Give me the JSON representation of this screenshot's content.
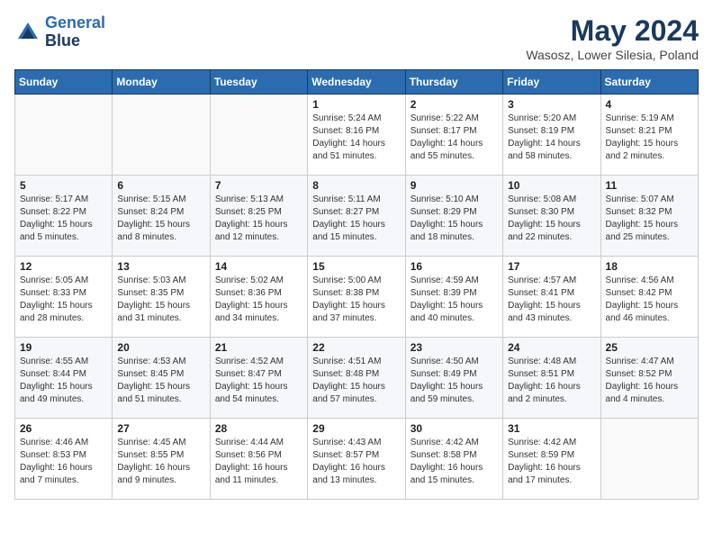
{
  "logo": {
    "line1": "General",
    "line2": "Blue"
  },
  "title": "May 2024",
  "subtitle": "Wasosz, Lower Silesia, Poland",
  "weekdays": [
    "Sunday",
    "Monday",
    "Tuesday",
    "Wednesday",
    "Thursday",
    "Friday",
    "Saturday"
  ],
  "weeks": [
    [
      {
        "day": "",
        "info": ""
      },
      {
        "day": "",
        "info": ""
      },
      {
        "day": "",
        "info": ""
      },
      {
        "day": "1",
        "info": "Sunrise: 5:24 AM\nSunset: 8:16 PM\nDaylight: 14 hours\nand 51 minutes."
      },
      {
        "day": "2",
        "info": "Sunrise: 5:22 AM\nSunset: 8:17 PM\nDaylight: 14 hours\nand 55 minutes."
      },
      {
        "day": "3",
        "info": "Sunrise: 5:20 AM\nSunset: 8:19 PM\nDaylight: 14 hours\nand 58 minutes."
      },
      {
        "day": "4",
        "info": "Sunrise: 5:19 AM\nSunset: 8:21 PM\nDaylight: 15 hours\nand 2 minutes."
      }
    ],
    [
      {
        "day": "5",
        "info": "Sunrise: 5:17 AM\nSunset: 8:22 PM\nDaylight: 15 hours\nand 5 minutes."
      },
      {
        "day": "6",
        "info": "Sunrise: 5:15 AM\nSunset: 8:24 PM\nDaylight: 15 hours\nand 8 minutes."
      },
      {
        "day": "7",
        "info": "Sunrise: 5:13 AM\nSunset: 8:25 PM\nDaylight: 15 hours\nand 12 minutes."
      },
      {
        "day": "8",
        "info": "Sunrise: 5:11 AM\nSunset: 8:27 PM\nDaylight: 15 hours\nand 15 minutes."
      },
      {
        "day": "9",
        "info": "Sunrise: 5:10 AM\nSunset: 8:29 PM\nDaylight: 15 hours\nand 18 minutes."
      },
      {
        "day": "10",
        "info": "Sunrise: 5:08 AM\nSunset: 8:30 PM\nDaylight: 15 hours\nand 22 minutes."
      },
      {
        "day": "11",
        "info": "Sunrise: 5:07 AM\nSunset: 8:32 PM\nDaylight: 15 hours\nand 25 minutes."
      }
    ],
    [
      {
        "day": "12",
        "info": "Sunrise: 5:05 AM\nSunset: 8:33 PM\nDaylight: 15 hours\nand 28 minutes."
      },
      {
        "day": "13",
        "info": "Sunrise: 5:03 AM\nSunset: 8:35 PM\nDaylight: 15 hours\nand 31 minutes."
      },
      {
        "day": "14",
        "info": "Sunrise: 5:02 AM\nSunset: 8:36 PM\nDaylight: 15 hours\nand 34 minutes."
      },
      {
        "day": "15",
        "info": "Sunrise: 5:00 AM\nSunset: 8:38 PM\nDaylight: 15 hours\nand 37 minutes."
      },
      {
        "day": "16",
        "info": "Sunrise: 4:59 AM\nSunset: 8:39 PM\nDaylight: 15 hours\nand 40 minutes."
      },
      {
        "day": "17",
        "info": "Sunrise: 4:57 AM\nSunset: 8:41 PM\nDaylight: 15 hours\nand 43 minutes."
      },
      {
        "day": "18",
        "info": "Sunrise: 4:56 AM\nSunset: 8:42 PM\nDaylight: 15 hours\nand 46 minutes."
      }
    ],
    [
      {
        "day": "19",
        "info": "Sunrise: 4:55 AM\nSunset: 8:44 PM\nDaylight: 15 hours\nand 49 minutes."
      },
      {
        "day": "20",
        "info": "Sunrise: 4:53 AM\nSunset: 8:45 PM\nDaylight: 15 hours\nand 51 minutes."
      },
      {
        "day": "21",
        "info": "Sunrise: 4:52 AM\nSunset: 8:47 PM\nDaylight: 15 hours\nand 54 minutes."
      },
      {
        "day": "22",
        "info": "Sunrise: 4:51 AM\nSunset: 8:48 PM\nDaylight: 15 hours\nand 57 minutes."
      },
      {
        "day": "23",
        "info": "Sunrise: 4:50 AM\nSunset: 8:49 PM\nDaylight: 15 hours\nand 59 minutes."
      },
      {
        "day": "24",
        "info": "Sunrise: 4:48 AM\nSunset: 8:51 PM\nDaylight: 16 hours\nand 2 minutes."
      },
      {
        "day": "25",
        "info": "Sunrise: 4:47 AM\nSunset: 8:52 PM\nDaylight: 16 hours\nand 4 minutes."
      }
    ],
    [
      {
        "day": "26",
        "info": "Sunrise: 4:46 AM\nSunset: 8:53 PM\nDaylight: 16 hours\nand 7 minutes."
      },
      {
        "day": "27",
        "info": "Sunrise: 4:45 AM\nSunset: 8:55 PM\nDaylight: 16 hours\nand 9 minutes."
      },
      {
        "day": "28",
        "info": "Sunrise: 4:44 AM\nSunset: 8:56 PM\nDaylight: 16 hours\nand 11 minutes."
      },
      {
        "day": "29",
        "info": "Sunrise: 4:43 AM\nSunset: 8:57 PM\nDaylight: 16 hours\nand 13 minutes."
      },
      {
        "day": "30",
        "info": "Sunrise: 4:42 AM\nSunset: 8:58 PM\nDaylight: 16 hours\nand 15 minutes."
      },
      {
        "day": "31",
        "info": "Sunrise: 4:42 AM\nSunset: 8:59 PM\nDaylight: 16 hours\nand 17 minutes."
      },
      {
        "day": "",
        "info": ""
      }
    ]
  ]
}
